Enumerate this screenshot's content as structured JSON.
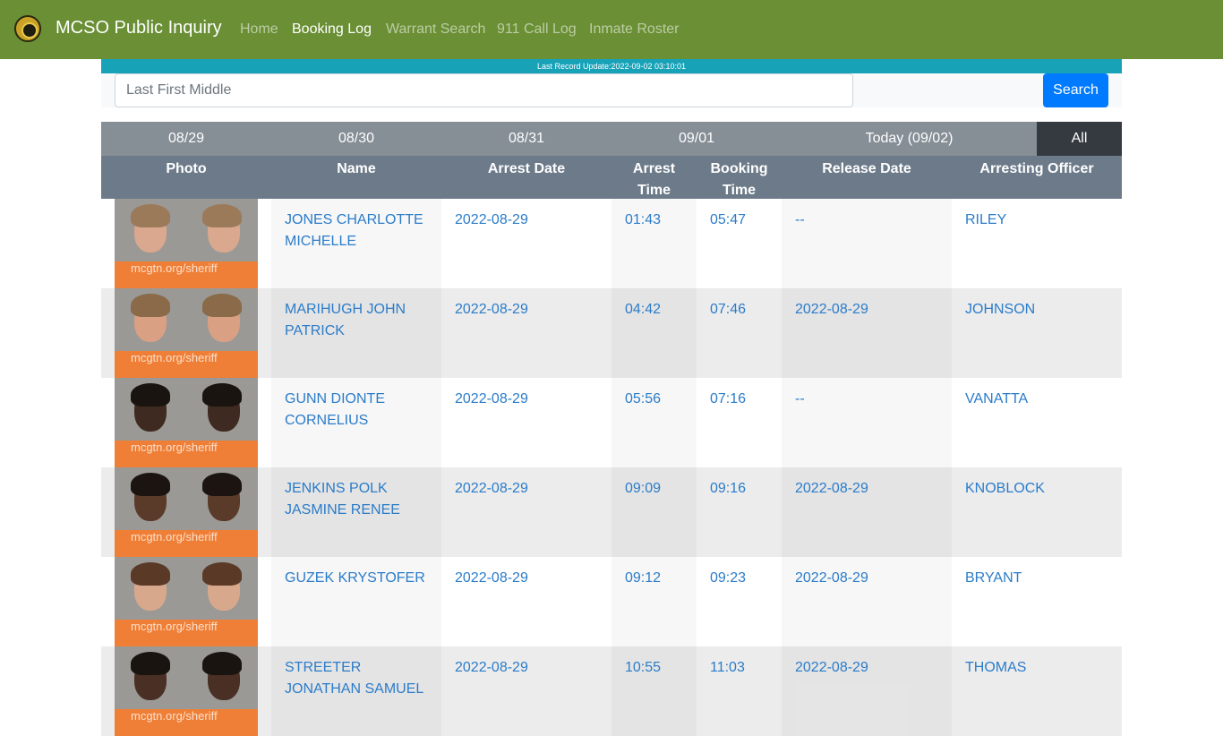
{
  "nav": {
    "brand": "MCSO Public Inquiry",
    "links": [
      {
        "label": "Home",
        "active": false
      },
      {
        "label": "Booking Log",
        "active": true
      },
      {
        "label": "Warrant Search",
        "active": false
      },
      {
        "label": "911 Call Log",
        "active": false
      },
      {
        "label": "Inmate Roster",
        "active": false
      }
    ]
  },
  "update_text": "Last Record Update:2022-09-02 03:10:01",
  "search": {
    "placeholder": "Last First Middle",
    "value": "",
    "button": "Search"
  },
  "date_tabs": [
    {
      "label": "08/29",
      "active": false
    },
    {
      "label": "08/30",
      "active": false
    },
    {
      "label": "08/31",
      "active": false
    },
    {
      "label": "09/01",
      "active": false
    },
    {
      "label": "Today (09/02)",
      "active": false
    },
    {
      "label": "All",
      "active": true
    }
  ],
  "columns": [
    "Photo",
    "Name",
    "Arrest Date",
    "Arrest Time",
    "Booking Time",
    "Release Date",
    "Arresting Officer"
  ],
  "watermark": "mcgtn.org/sheriff",
  "rows": [
    {
      "name": "JONES CHARLOTTE MICHELLE",
      "arrest_date": "2022-08-29",
      "arrest_time": "01:43",
      "booking_time": "05:47",
      "release_date": "--",
      "officer": "RILEY",
      "skin": "#d9a88e",
      "hair": "#9b7a5a"
    },
    {
      "name": "MARIHUGH JOHN PATRICK",
      "arrest_date": "2022-08-29",
      "arrest_time": "04:42",
      "booking_time": "07:46",
      "release_date": "2022-08-29",
      "officer": "JOHNSON",
      "skin": "#d9a084",
      "hair": "#8a6a48"
    },
    {
      "name": "GUNN DIONTE CORNELIUS",
      "arrest_date": "2022-08-29",
      "arrest_time": "05:56",
      "booking_time": "07:16",
      "release_date": "--",
      "officer": "VANATTA",
      "skin": "#3e2a20",
      "hair": "#1a1410"
    },
    {
      "name": "JENKINS POLK JASMINE RENEE",
      "arrest_date": "2022-08-29",
      "arrest_time": "09:09",
      "booking_time": "09:16",
      "release_date": "2022-08-29",
      "officer": "KNOBLOCK",
      "skin": "#5a3a28",
      "hair": "#1c1410"
    },
    {
      "name": "GUZEK KRYSTOFER",
      "arrest_date": "2022-08-29",
      "arrest_time": "09:12",
      "booking_time": "09:23",
      "release_date": "2022-08-29",
      "officer": "BRYANT",
      "skin": "#d8a88c",
      "hair": "#5a3a26"
    },
    {
      "name": "STREETER JONATHAN SAMUEL",
      "arrest_date": "2022-08-29",
      "arrest_time": "10:55",
      "booking_time": "11:03",
      "release_date": "2022-08-29",
      "officer": "THOMAS",
      "skin": "#4a3024",
      "hair": "#1a1410"
    }
  ]
}
